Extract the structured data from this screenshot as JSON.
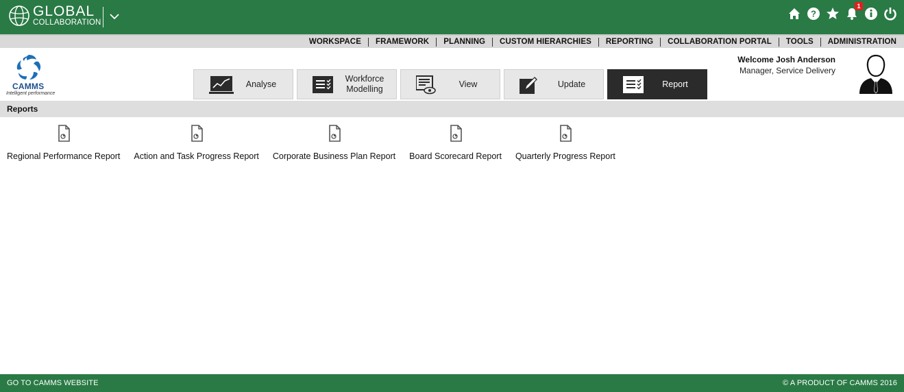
{
  "app": {
    "brand_line1": "GLOBAL",
    "brand_line2": "COLLABORATION",
    "notification_count": "1"
  },
  "menu": {
    "items": [
      "WORKSPACE",
      "FRAMEWORK",
      "PLANNING",
      "CUSTOM HIERARCHIES",
      "REPORTING",
      "COLLABORATION PORTAL",
      "TOOLS",
      "ADMINISTRATION"
    ]
  },
  "logo": {
    "name": "CAMMS",
    "tagline": "Intelligent performance"
  },
  "tiles": [
    {
      "label": "Analyse",
      "icon": "chart-icon"
    },
    {
      "label": "Workforce Modelling",
      "icon": "checklist-icon"
    },
    {
      "label": "View",
      "icon": "view-icon"
    },
    {
      "label": "Update",
      "icon": "pen-icon"
    },
    {
      "label": "Report",
      "icon": "report-icon"
    }
  ],
  "user": {
    "welcome": "Welcome Josh Anderson",
    "role": "Manager, Service Delivery"
  },
  "section": {
    "title": "Reports"
  },
  "reports": [
    {
      "label": "Regional Performance Report"
    },
    {
      "label": "Action and Task Progress Report"
    },
    {
      "label": "Corporate Business Plan Report"
    },
    {
      "label": "Board Scorecard Report"
    },
    {
      "label": "Quarterly Progress Report"
    }
  ],
  "footer": {
    "left": "GO TO CAMMS WEBSITE",
    "right": "© A PRODUCT OF CAMMS 2016"
  },
  "colors": {
    "brand_green": "#2a7a45",
    "active_tile": "#2b2b2b",
    "badge_red": "#e02020",
    "logo_blue": "#1d6fb8"
  }
}
